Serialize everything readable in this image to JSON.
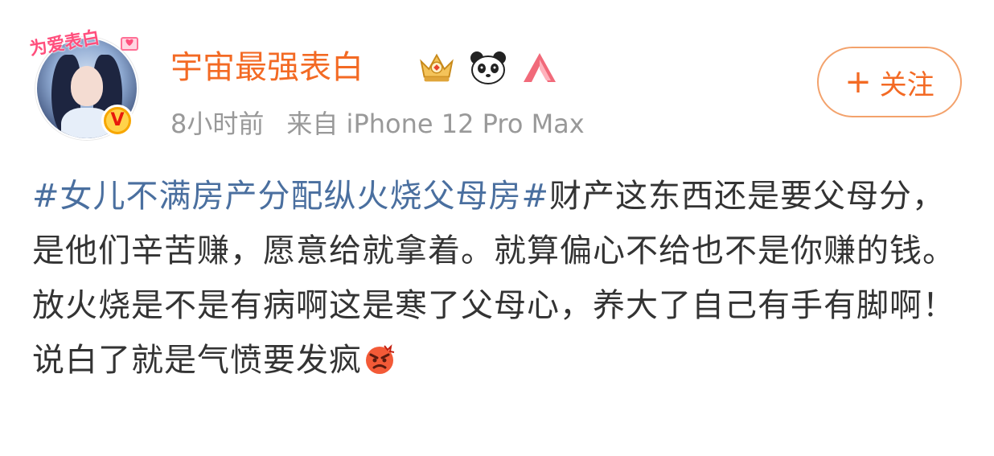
{
  "user": {
    "name": "宇宙最强表白",
    "avatar_sticker_text": "为爱表白",
    "verified_mark": "V"
  },
  "meta": {
    "time": "8小时前",
    "source": "来自 iPhone 12 Pro Max"
  },
  "follow": {
    "plus": "+",
    "label": "关注"
  },
  "post": {
    "hashtag": "#女儿不满房产分配纵火烧父母房#",
    "text": "财产这东西还是要父母分，是他们辛苦赚，愿意给就拿着。就算偏心不给也不是你赚的钱。放火烧是不是有病啊这是寒了父母心，养大了自己有手有脚啊！说白了就是气愤要发疯"
  },
  "icons": {
    "badge_1": "crown-badge-icon",
    "badge_2": "panda-icon",
    "badge_3": "triangle-a-logo-icon",
    "emoji": "angry-face-emoji-icon"
  },
  "colors": {
    "username": "#f36a24",
    "hashtag": "#4a6f9f",
    "meta": "#999999",
    "follow_border": "#f3a26c",
    "body_text": "#333333"
  }
}
